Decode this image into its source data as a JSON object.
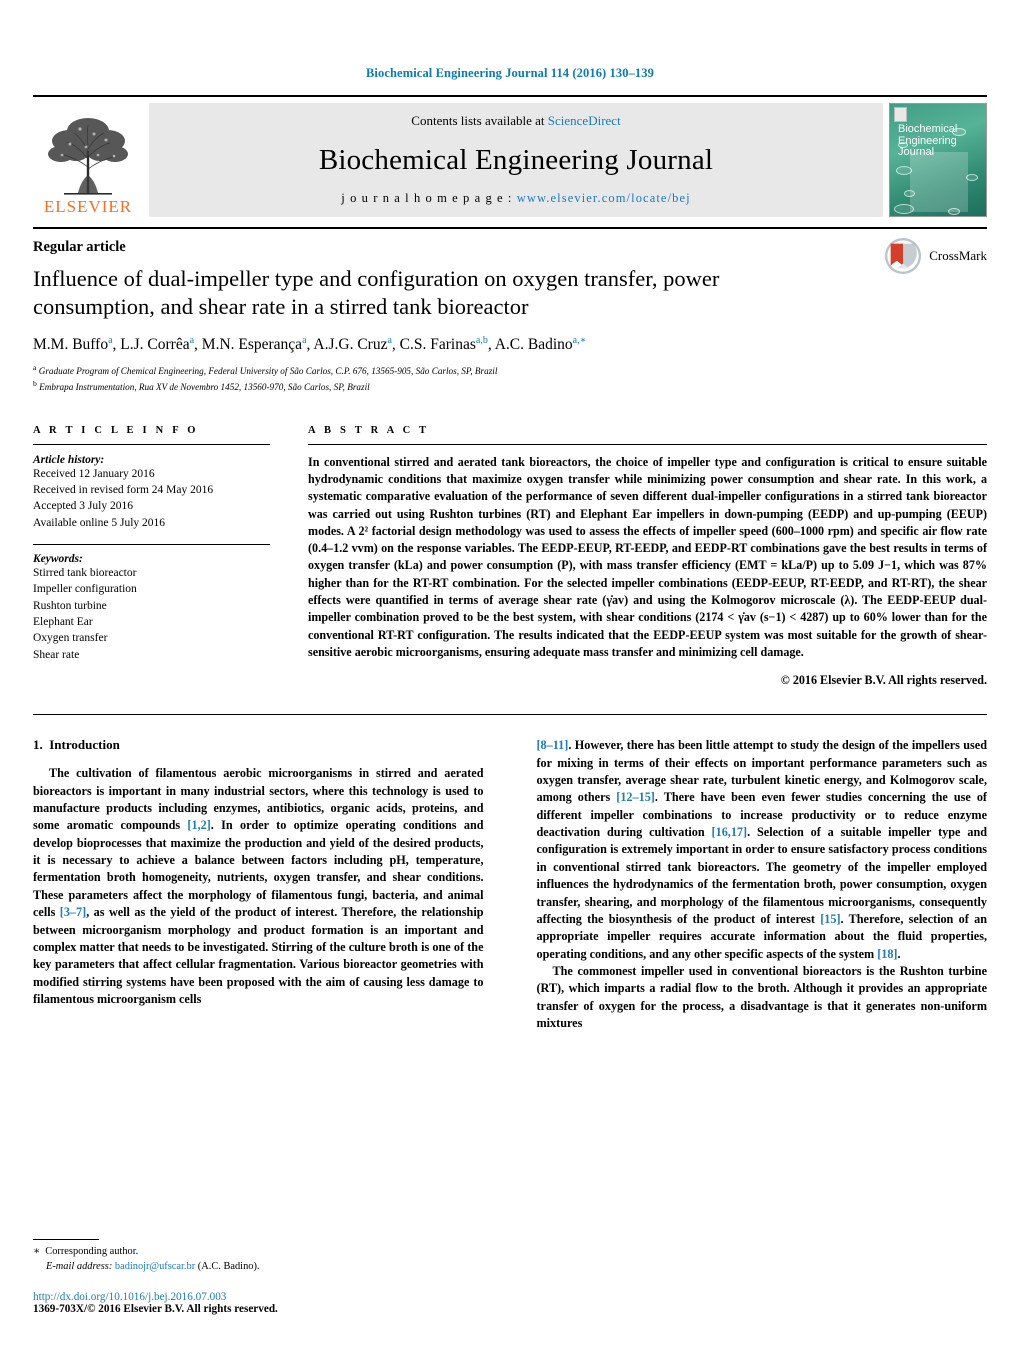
{
  "running_head": "Biochemical Engineering Journal 114 (2016) 130–139",
  "masthead": {
    "publisher_name": "ELSEVIER",
    "contents_prefix": "Contents lists available at ",
    "contents_link": "ScienceDirect",
    "journal_name": "Biochemical Engineering Journal",
    "homepage_prefix": "j o u r n a l   h o m e p a g e :  ",
    "homepage_url": "www.elsevier.com/locate/bej",
    "cover_title_line1": "Biochemical",
    "cover_title_line2": "Engineering",
    "cover_title_line3": "Journal"
  },
  "article": {
    "type_label": "Regular article",
    "title": "Influence of dual-impeller type and configuration on oxygen transfer, power consumption, and shear rate in a stirred tank bioreactor",
    "authors_html": "M.M. Buffo<sup>a</sup>, L.J. Corrêa<sup>a</sup>, M.N. Esperança<sup>a</sup>, A.J.G. Cruz<sup>a</sup>, C.S. Farinas<sup>a,b</sup>, A.C. Badino<sup>a,</sup><sup>∗</sup>",
    "affiliation_a": "Graduate Program of Chemical Engineering, Federal University of São Carlos, C.P. 676, 13565-905, São Carlos, SP, Brazil",
    "affiliation_b": "Embrapa Instrumentation, Rua XV de Novembro 1452, 13560-970, São Carlos, SP, Brazil",
    "crossmark_label": "CrossMark"
  },
  "article_info": {
    "heading": "A R T I C L E   I N F O",
    "history_label": "Article history:",
    "history": [
      "Received 12 January 2016",
      "Received in revised form 24 May 2016",
      "Accepted 3 July 2016",
      "Available online 5 July 2016"
    ],
    "keywords_label": "Keywords:",
    "keywords": [
      "Stirred tank bioreactor",
      "Impeller configuration",
      "Rushton turbine",
      "Elephant Ear",
      "Oxygen transfer",
      "Shear rate"
    ]
  },
  "abstract": {
    "heading": "A B S T R A C T",
    "text": "In conventional stirred and aerated tank bioreactors, the choice of impeller type and configuration is critical to ensure suitable hydrodynamic conditions that maximize oxygen transfer while minimizing power consumption and shear rate. In this work, a systematic comparative evaluation of the performance of seven different dual-impeller configurations in a stirred tank bioreactor was carried out using Rushton turbines (RT) and Elephant Ear impellers in down-pumping (EEDP) and up-pumping (EEUP) modes. A 2² factorial design methodology was used to assess the effects of impeller speed (600–1000 rpm) and specific air flow rate (0.4–1.2 vvm) on the response variables. The EEDP-EEUP, RT-EEDP, and EEDP-RT combinations gave the best results in terms of oxygen transfer (kLa) and power consumption (P), with mass transfer efficiency (EMT = kLa/P) up to 5.09 J−1, which was 87% higher than for the RT-RT combination. For the selected impeller combinations (EEDP-EEUP, RT-EEDP, and RT-RT), the shear effects were quantified in terms of average shear rate (γ̇av) and using the Kolmogorov microscale (λ). The EEDP-EEUP dual-impeller combination proved to be the best system, with shear conditions (2174 < γ̇av (s−1) < 4287) up to 60% lower than for the conventional RT-RT configuration. The results indicated that the EEDP-EEUP system was most suitable for the growth of shear-sensitive aerobic microorganisms, ensuring adequate mass transfer and minimizing cell damage.",
    "copyright": "© 2016 Elsevier B.V. All rights reserved."
  },
  "introduction": {
    "section_number": "1.",
    "section_title": "Introduction",
    "para1_a": "The cultivation of filamentous aerobic microorganisms in stirred and aerated bioreactors is important in many industrial sectors, where this technology is used to manufacture products including enzymes, antibiotics, organic acids, proteins, and some aromatic compounds ",
    "para1_ref1": "[1,2]",
    "para1_b": ". In order to optimize operating conditions and develop bioprocesses that maximize the production and yield of the desired products, it is necessary to achieve a balance between factors including pH, temperature, fermentation broth homogeneity, nutrients, oxygen transfer, and shear conditions. These parameters affect the morphology of filamentous fungi, bacteria, and animal cells ",
    "para1_ref2": "[3–7]",
    "para1_c": ", as well as the yield of the product of interest. Therefore, the relationship between microorganism morphology and product formation is an important and complex matter that needs to be investigated. Stirring of the culture broth is one of the key parameters that affect cellular fragmentation. Various bioreactor geometries with modified stirring systems have been proposed with the aim of causing less damage to filamentous microorganism cells ",
    "para1_ref3": "[8–11]",
    "para1_d": ". However, there has been little attempt to study the design of the impellers used for mixing in terms of their effects on important performance parameters such as oxygen transfer, average shear rate, turbulent kinetic energy, and Kolmogorov scale, among others ",
    "para1_ref4": "[12–15]",
    "para1_e": ". There have been even fewer studies concerning the use of different impeller combinations to increase productivity or to reduce enzyme deactivation during cultivation ",
    "para1_ref5": "[16,17]",
    "para1_f": ". Selection of a suitable impeller type and configuration is extremely important in order to ensure satisfactory process conditions in conventional stirred tank bioreactors. The geometry of the impeller employed influences the hydrodynamics of the fermentation broth, power consumption, oxygen transfer, shearing, and morphology of the filamentous microorganisms, consequently affecting the biosynthesis of the product of interest ",
    "para1_ref6": "[15]",
    "para1_g": ". Therefore, selection of an appropriate impeller requires accurate information about the fluid properties, operating conditions, and any other specific aspects of the system ",
    "para1_ref7": "[18]",
    "para1_h": ".",
    "para2": "The commonest impeller used in conventional bioreactors is the Rushton turbine (RT), which imparts a radial flow to the broth. Although it provides an appropriate transfer of oxygen for the process, a disadvantage is that it generates non-uniform mixtures"
  },
  "footer": {
    "corresponding_marker": "∗",
    "corresponding_label": "Corresponding author.",
    "email_label": "E-mail address:",
    "email": "badinojr@ufscar.br",
    "email_suffix": " (A.C. Badino).",
    "doi": "http://dx.doi.org/10.1016/j.bej.2016.07.003",
    "issn_line": "1369-703X/© 2016 Elsevier B.V. All rights reserved."
  },
  "colors": {
    "link_blue": "#1a7bbd",
    "running_head_blue": "#0b7ab5",
    "elsevier_orange": "#f37021",
    "band_gray": "#e8e8e8"
  }
}
